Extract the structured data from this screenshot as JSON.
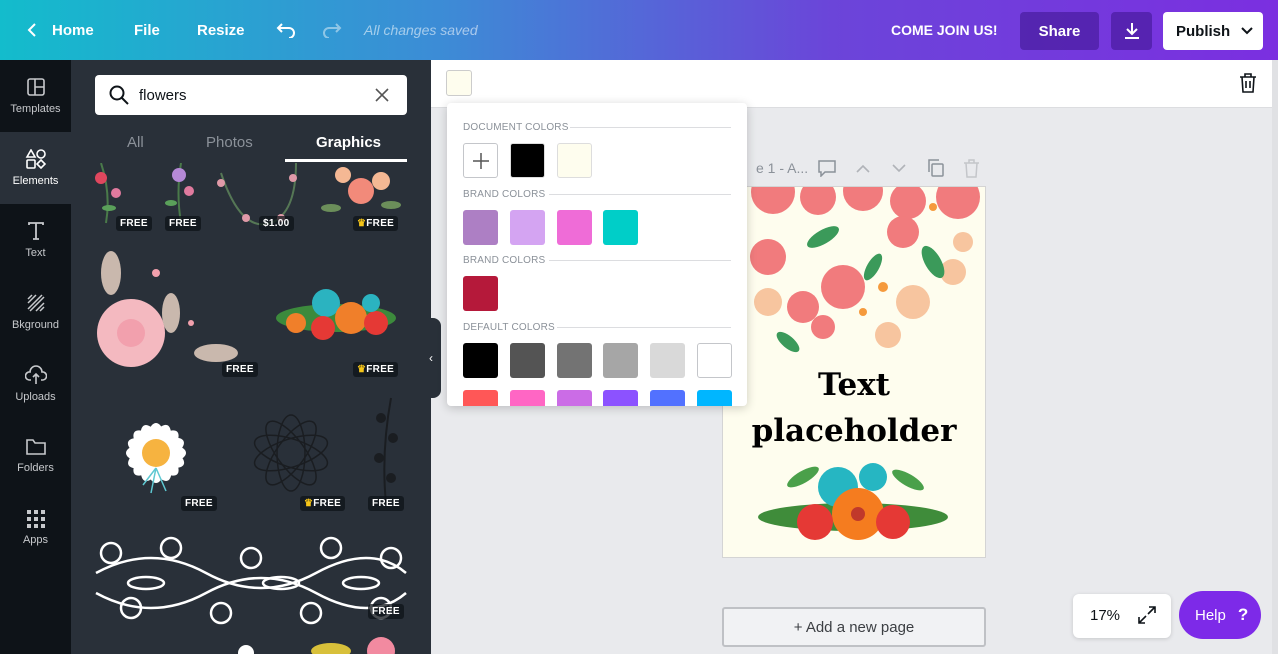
{
  "topbar": {
    "home": "Home",
    "file": "File",
    "resize": "Resize",
    "saved_status": "All changes saved",
    "join": "COME JOIN US!",
    "share": "Share",
    "publish": "Publish"
  },
  "rail": [
    {
      "label": "Templates",
      "icon": "templates-icon"
    },
    {
      "label": "Elements",
      "icon": "elements-icon"
    },
    {
      "label": "Text",
      "icon": "text-icon"
    },
    {
      "label": "Bkground",
      "icon": "background-icon"
    },
    {
      "label": "Uploads",
      "icon": "upload-icon"
    },
    {
      "label": "Folders",
      "icon": "folder-icon"
    },
    {
      "label": "Apps",
      "icon": "apps-icon"
    }
  ],
  "panel": {
    "search_value": "flowers",
    "tabs": [
      "All",
      "Photos",
      "Graphics"
    ],
    "badges": [
      "FREE",
      "FREE",
      "$1.00",
      "FREE",
      "FREE",
      "FREE",
      "FREE",
      "FREE",
      "FREE",
      "FREE"
    ]
  },
  "color_popup": {
    "document_title": "DOCUMENT COLORS",
    "document_colors": [
      "#000000",
      "#fefdee"
    ],
    "brand_title_1": "BRAND COLORS",
    "brand_colors_1": [
      "#ad7fc4",
      "#d4a4f2",
      "#ef6cd7",
      "#00cec8"
    ],
    "brand_title_2": "BRAND COLORS",
    "brand_colors_2": [
      "#b5193a"
    ],
    "default_title": "DEFAULT COLORS",
    "default_colors_row1": [
      "#000000",
      "#545454",
      "#737373",
      "#a6a6a6",
      "#d9d9d9",
      "#ffffff"
    ],
    "default_colors_row2": [
      "#ff5757",
      "#ff66c4",
      "#cb6ce6",
      "#8c52ff",
      "#5271ff",
      "#00b6ff"
    ]
  },
  "canvas": {
    "page_header": "e 1 - A...",
    "text_line1": "Text",
    "text_line2": "placeholder",
    "add_page": "+ Add a new page",
    "bg_color": "#fefdee"
  },
  "zoom": "17%",
  "help": "Help",
  "help_glyph": "?"
}
